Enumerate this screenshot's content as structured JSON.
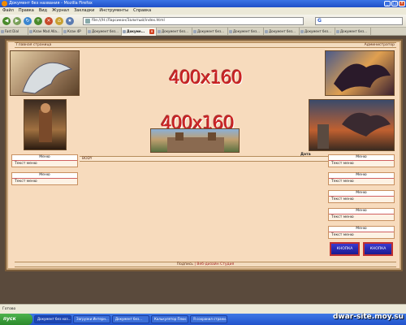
{
  "window": {
    "title": "Документ без названия - Mozilla Firefox"
  },
  "menu": [
    "Файл",
    "Правка",
    "Вид",
    "Журнал",
    "Закладки",
    "Инструменты",
    "Справка"
  ],
  "url": "file:///H:/Ларсикон/Залитый/index.html",
  "tabs": [
    {
      "label": "Fast Dial",
      "active": false
    },
    {
      "label": "Клан Mad Alla...",
      "active": false
    },
    {
      "label": "Клан 4Р",
      "active": false
    },
    {
      "label": "Документ без...",
      "active": false
    },
    {
      "label": "Докуме...",
      "active": true
    },
    {
      "label": "Документ без...",
      "active": false
    },
    {
      "label": "Документ без...",
      "active": false
    },
    {
      "label": "Документ без...",
      "active": false
    },
    {
      "label": "Документ без...",
      "active": false
    },
    {
      "label": "Документ без...",
      "active": false
    },
    {
      "label": "Документ без...",
      "active": false
    }
  ],
  "page": {
    "home": "Главная страница",
    "admin": "Администратор",
    "placeholder1": "400x160",
    "placeholder2": "400x160",
    "date": "Дата",
    "body": "BODY",
    "footer_left": "Подпись",
    "footer_right": "Веб-дизайн Студия",
    "left_menus": [
      {
        "title": "Меню",
        "text": "Текст меню"
      },
      {
        "title": "Меню",
        "text": "Текст меню"
      }
    ],
    "right_menus": [
      {
        "title": "Меню",
        "text": "Текст меню"
      },
      {
        "title": "Меню",
        "text": "Текст меню"
      },
      {
        "title": "Меню",
        "text": "Текст меню"
      },
      {
        "title": "Меню",
        "text": "Текст меню"
      },
      {
        "title": "Меню",
        "text": "Текст меню"
      }
    ],
    "buttons": [
      "КНОПКА",
      "КНОПКА"
    ]
  },
  "status": "Готово",
  "taskbar": {
    "start": "пуск",
    "items": [
      "Документ без наз...",
      "Загрузки Интерн...",
      "Документ без...",
      "Калькулятор Плюс",
      "Я сохранил страни..."
    ]
  },
  "watermark": "dwar-site.moy.su"
}
